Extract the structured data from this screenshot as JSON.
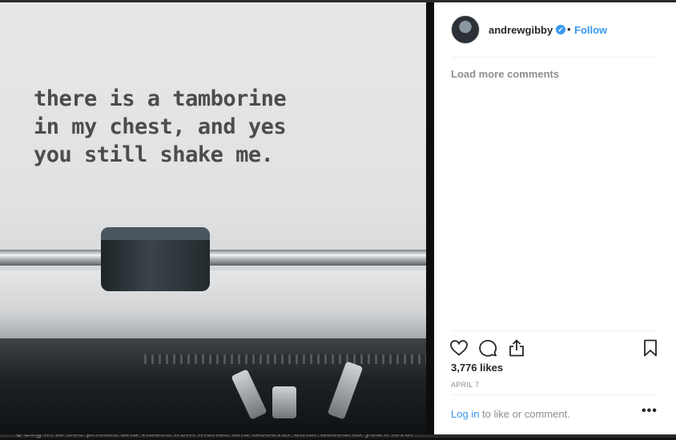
{
  "post": {
    "typed_text": "there is a tamborine\nin my chest, and yes\nyou still shake me."
  },
  "header": {
    "username": "andrewgibby",
    "separator": "•",
    "follow_label": "Follow"
  },
  "comments": {
    "load_more_label": "Load more comments"
  },
  "actions": {
    "icons": [
      "heart-icon",
      "comment-icon",
      "share-icon",
      "bookmark-icon"
    ],
    "likes_text": "3,776 likes",
    "date_text": "APRIL 7"
  },
  "footer": {
    "login_link": "Log in",
    "login_suffix": " to like or comment.",
    "more_label": "•••"
  },
  "backdrop": {
    "chevron": "⌄",
    "signup_text": "Log in to see photos and videos from friends and discover other accounts you'll love."
  },
  "colors": {
    "accent": "#3897f0",
    "text": "#262626",
    "muted": "#8e8e8e"
  }
}
